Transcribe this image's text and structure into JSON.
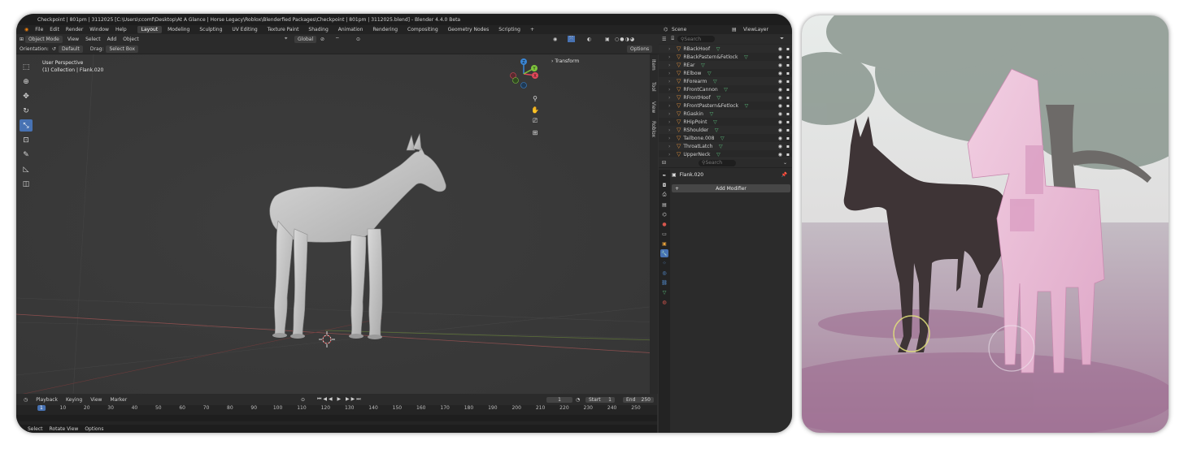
{
  "window": {
    "title": "Checkpoint | 801pm | 3112025 [C:\\Users\\ccomf\\Desktop\\At A Glance | Horse Legacy\\Roblox\\Blenderfied Packages\\Checkpoint | 801pm | 3112025.blend] - Blender 4.4.0 Beta"
  },
  "menu": [
    "File",
    "Edit",
    "Render",
    "Window",
    "Help"
  ],
  "workspaces": [
    "Layout",
    "Modeling",
    "Sculpting",
    "UV Editing",
    "Texture Paint",
    "Shading",
    "Animation",
    "Rendering",
    "Compositing",
    "Geometry Nodes",
    "Scripting"
  ],
  "workspace_add": "+",
  "scene": "Scene",
  "view_layer": "ViewLayer",
  "header": {
    "mode": "Object Mode",
    "menus": [
      "View",
      "Select",
      "Add",
      "Object"
    ],
    "transform_orientation": "Global",
    "options": "Options"
  },
  "options_bar": {
    "orientation_label": "Orientation:",
    "orientation_value": "Default",
    "drag_label": "Drag:",
    "drag_value": "Select Box"
  },
  "viewport": {
    "perspective": "User Perspective",
    "collection": "(1) Collection | Flank.020",
    "transform_panel": "Transform",
    "side_tabs": [
      "Item",
      "Tool",
      "View",
      "Roblox"
    ],
    "axes": {
      "z": "Z",
      "y": "Y",
      "x": "X"
    }
  },
  "tools": [
    "tweak",
    "cursor",
    "move",
    "rotate",
    "scale",
    "transform",
    "annotate",
    "measure",
    "add-cube"
  ],
  "outliner": {
    "search_placeholder": "Search",
    "items": [
      "RBackHoof",
      "RBackPastern&Fetlock",
      "REar",
      "RElbow",
      "RForearm",
      "RFrontCannon",
      "RFrontHoof",
      "RFrontPastern&Fetlock",
      "RGaskin",
      "RHipPoint",
      "RShoulder",
      "Tailbone.008",
      "ThroatLatch",
      "UpperNeck"
    ]
  },
  "properties": {
    "search_placeholder": "Search",
    "object_name": "Flank.020",
    "add_modifier": "Add Modifier"
  },
  "timeline": {
    "menus": [
      "Playback",
      "Keying",
      "View",
      "Marker"
    ],
    "current_frame": "1",
    "start_label": "Start",
    "start_value": "1",
    "end_label": "End",
    "end_value": "250",
    "ticks": [
      "1",
      "10",
      "20",
      "30",
      "40",
      "50",
      "60",
      "70",
      "80",
      "90",
      "100",
      "110",
      "120",
      "130",
      "140",
      "150",
      "160",
      "170",
      "180",
      "190",
      "200",
      "210",
      "220",
      "230",
      "240",
      "250"
    ]
  },
  "status": [
    "Select",
    "Rotate View",
    "Options"
  ],
  "colors": {
    "accent": "#4772b3",
    "axis_x": "#e0485a",
    "axis_y": "#7ec53c",
    "axis_z": "#3a86d6"
  }
}
